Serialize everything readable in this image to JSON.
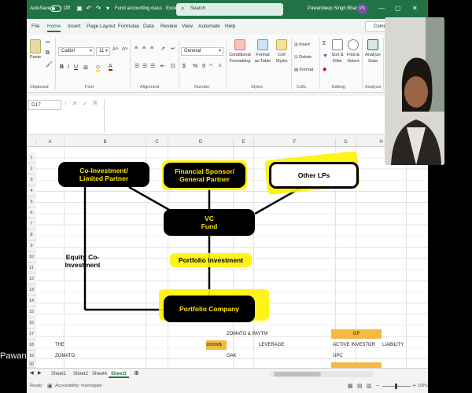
{
  "titlebar": {
    "autosave_label": "AutoSave",
    "autosave_state": "Off",
    "doc_title": "Fund accounting class",
    "app_suffix": "Excel",
    "search_placeholder": "Search",
    "user_name": "Pawandeep Singh Bhandari",
    "user_initials": "PS"
  },
  "menu_tabs": [
    "File",
    "Home",
    "Insert",
    "Page Layout",
    "Formulas",
    "Data",
    "Review",
    "View",
    "Automate",
    "Help"
  ],
  "comments_label": "Comm",
  "ribbon": {
    "paste_label": "Paste",
    "font_name": "Calibri",
    "font_size": "11",
    "number_format": "General",
    "conditional_formatting": "Conditional Formatting",
    "format_as_table": "Format as Table",
    "cell_styles": "Cell Styles",
    "insert": "Insert",
    "delete": "Delete",
    "format": "Format",
    "sort_filter": "Sort & Filter",
    "find_select": "Find & Select",
    "analyze_data": "Analyze Data",
    "groups": [
      "Clipboard",
      "Font",
      "Alignment",
      "Number",
      "Styles",
      "Cells",
      "Editing",
      "Analysis"
    ]
  },
  "formula_bar": {
    "name_box": "D17",
    "formula": ""
  },
  "columns": [
    "A",
    "B",
    "C",
    "D",
    "E",
    "F",
    "G",
    "H"
  ],
  "rows": [
    "1",
    "2",
    "3",
    "4",
    "5",
    "6",
    "7",
    "8",
    "9",
    "10",
    "11",
    "12",
    "13",
    "14",
    "15",
    "16",
    "17",
    "18",
    "19",
    "20"
  ],
  "diagram": {
    "co_investment": "Co-Investment/ Limited Partner",
    "financial_sponsor": "Financial Sponsor/ General Partner",
    "other_lps": "Other LPs",
    "vc_fund": "VC Fund",
    "portfolio_investment": "Portfolio Investment",
    "equity_co_investment": "Equity Co-Investment",
    "portfolio_company": "Portfolio Company"
  },
  "cells": {
    "r17_f": "ZOMATO & PAYTM",
    "r17_h": "GP",
    "r18_b": "THE",
    "r18_e": "2000M$",
    "r18_f": "LEVERAGE",
    "r18_h": "ACTIVE INVESTOR",
    "r18_i": "LIABILITY",
    "r19_b": "ZOMATO",
    "r19_f": "OAK",
    "r19_h": "UPC"
  },
  "sheets": [
    "Sheet1",
    "Sheet2",
    "Sheet4",
    "Sheet3"
  ],
  "active_sheet": "Sheet3",
  "status": {
    "ready": "Ready",
    "accessibility": "Accessibility: Investigate",
    "zoom": "100%"
  },
  "presenter_name_overlay": "Pawan"
}
